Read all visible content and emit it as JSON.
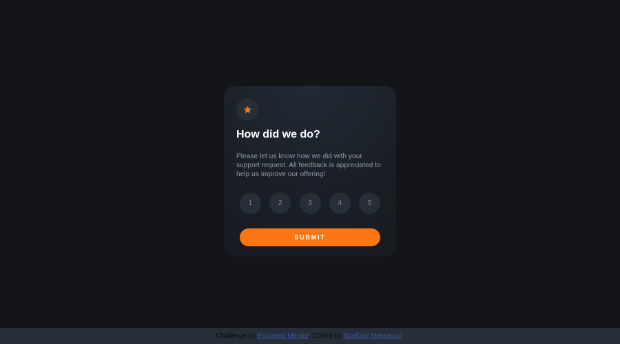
{
  "card": {
    "icon": "star-icon",
    "title": "How did we do?",
    "description": "Please let us know how we did with your support request. All feedback is appreciated to help us improve our offering!",
    "ratings": [
      "1",
      "2",
      "3",
      "4",
      "5"
    ],
    "submit_label": "SUBMIT"
  },
  "attribution": {
    "challenge_prefix": "Challenge by",
    "challenge_link": "Frontend Mentor",
    "coded_prefix": ". Coded by",
    "coded_link": "Abelbari Messaoud",
    "suffix": "."
  },
  "colors": {
    "background": "#131518",
    "card": "#1f2530",
    "accent": "#fc7614",
    "circle": "#262e38",
    "text_muted": "#959eac",
    "link": "#3e52a3"
  }
}
